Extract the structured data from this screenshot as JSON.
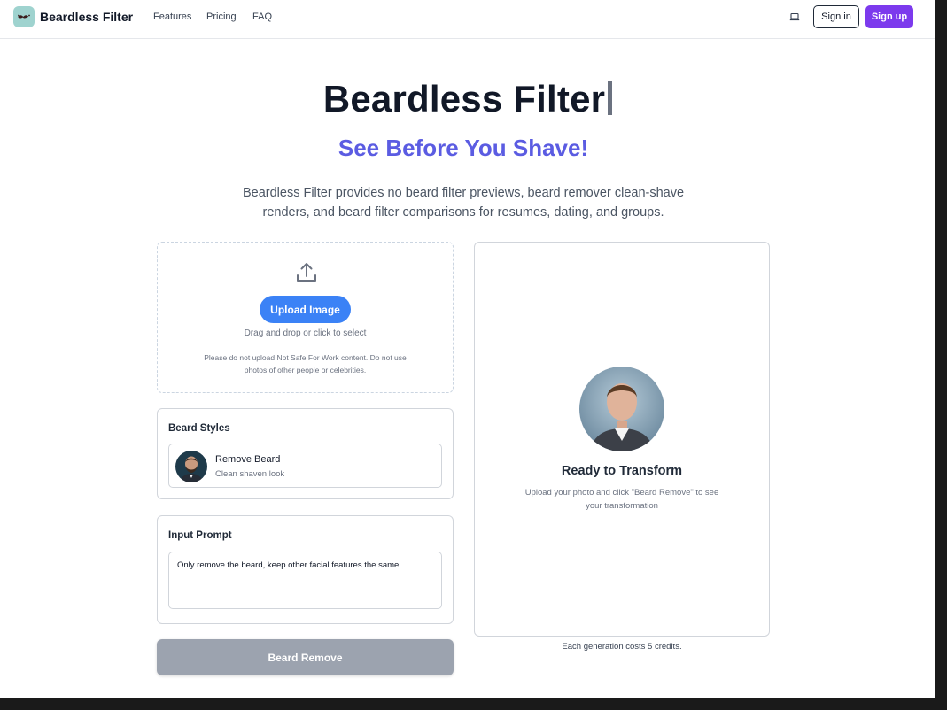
{
  "header": {
    "brand": "Beardless Filter",
    "nav": [
      "Features",
      "Pricing",
      "FAQ"
    ],
    "signin_label": "Sign in",
    "signup_label": "Sign up"
  },
  "hero": {
    "title": "Beardless Filter",
    "subtitle": "See Before You Shave!",
    "description": "Beardless Filter provides no beard filter previews, beard remover clean-shave renders, and beard filter comparisons for resumes, dating, and groups."
  },
  "upload": {
    "button_label": "Upload Image",
    "hint": "Drag and drop or click to select",
    "warning": "Please do not upload Not Safe For Work content. Do not use photos of other people or celebrities."
  },
  "beard_styles": {
    "title": "Beard Styles",
    "items": [
      {
        "name": "Remove Beard",
        "description": "Clean shaven look"
      }
    ]
  },
  "input_prompt": {
    "title": "Input Prompt",
    "value": "Only remove the beard, keep other facial features the same."
  },
  "action": {
    "label": "Beard Remove"
  },
  "preview": {
    "title": "Ready to Transform",
    "text": "Upload your photo and click \"Beard Remove\" to see your transformation"
  },
  "cost_note": "Each generation costs 5 credits.",
  "colors": {
    "accent_purple": "#7c3aed",
    "subtitle_blue": "#5b5ce2",
    "upload_blue": "#3b82f6",
    "disabled_gray": "#9ca3af"
  }
}
